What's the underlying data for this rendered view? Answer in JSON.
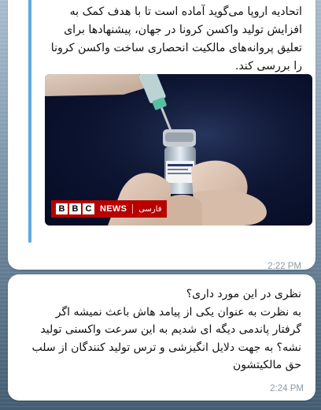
{
  "messages": [
    {
      "lines": [
        "اتحادیه اروپا می‌گوید آماده است تا با هدف کمک به",
        "افزایش تولید واکسن کرونا در جهان، پیشنهادها برای",
        "تعلیق پروانه‌های مالکیت انحصاری ساخت واکسن کرونا",
        "را بررسی کند."
      ],
      "media": {
        "logo_letters": [
          "B",
          "B",
          "C"
        ],
        "logo_word": "NEWS",
        "logo_lang": "فارسی"
      },
      "time": "2:22 PM"
    },
    {
      "lines": [
        "نظری در این مورد داری؟",
        "به نظرت به عنوان یکی از پیامد هاش باعث نمیشه اگر",
        "گرفتار پاندمی دیگه ای شدیم به این سرعت واکسنی تولید",
        "نشه؟ به جهت دلایل انگیزشی و ترس تولید کنندگان از سلب",
        "حق مالکیتشون"
      ],
      "time": "2:24 PM"
    }
  ],
  "colors": {
    "bubble": "#ffffff",
    "accent_bar": "#5ea9de",
    "timestamp": "#8c9aa6",
    "bbc_red": "#b80000"
  }
}
